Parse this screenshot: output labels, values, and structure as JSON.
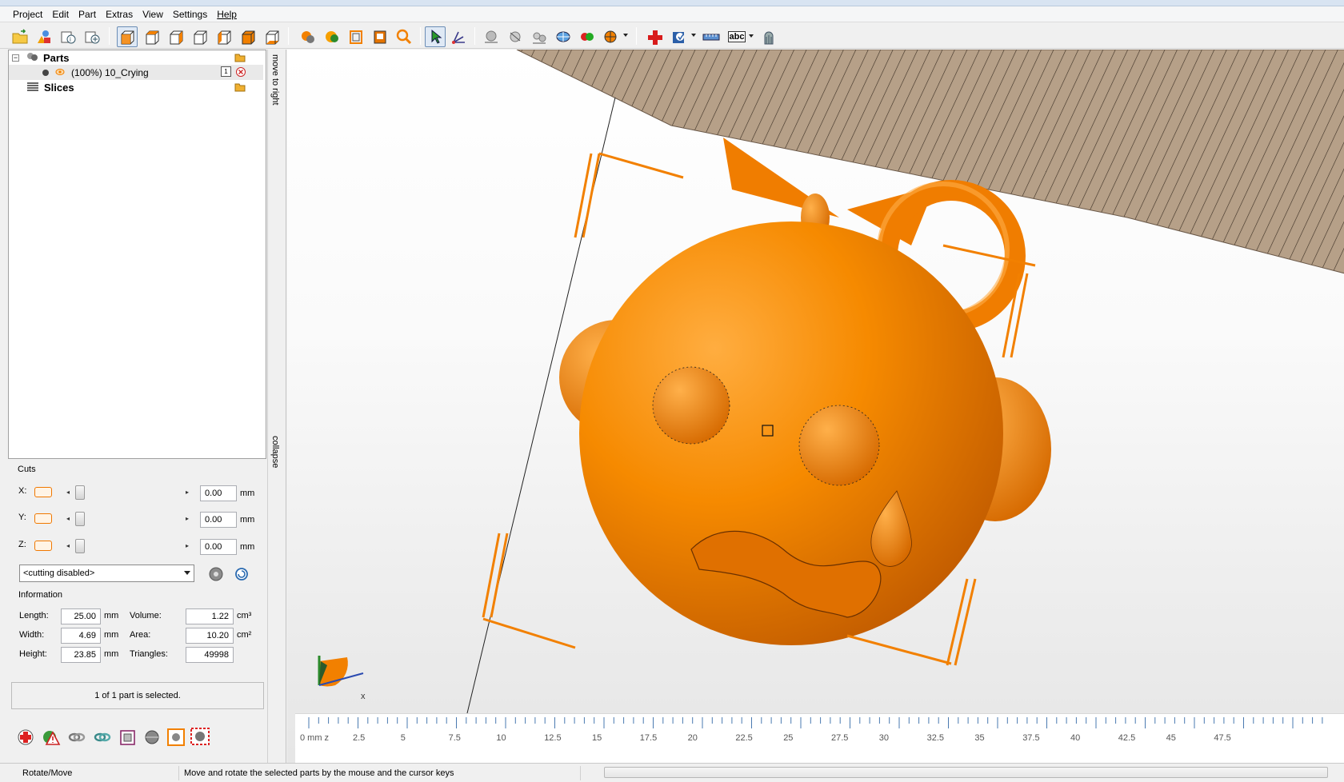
{
  "menu": {
    "items": [
      "Project",
      "Edit",
      "Part",
      "Extras",
      "View",
      "Settings",
      "Help"
    ]
  },
  "toolbar": {
    "icons": [
      "open-folder-icon",
      "add-part-icon",
      "part-info-icon",
      "add-copy-icon",
      "view-3d-icon",
      "view-front-icon",
      "view-right-icon",
      "view-back-icon",
      "view-left-icon",
      "view-top-icon",
      "view-bottom-icon",
      "render-solid-icon",
      "render-shaded-icon",
      "render-wireframe-icon",
      "render-transparent-icon",
      "zoom-icon",
      "select-arrow-icon",
      "measure-icon",
      "sphere-icon",
      "sphere-cut-icon",
      "spheres-icon",
      "texture-sphere-icon",
      "red-green-spheres-icon",
      "color-sphere-icon",
      "repair-cross-icon",
      "report-icon",
      "ruler-icon",
      "text-label-icon",
      "stand-icon"
    ],
    "text_label": "abc"
  },
  "tree": {
    "parts_label": "Parts",
    "part_item": "(100%) 10_Crying",
    "part_count": "1",
    "slices_label": "Slices"
  },
  "side_tabs": {
    "move_to_right": "move to right",
    "collapse": "collapse"
  },
  "cuts": {
    "title": "Cuts",
    "axes": [
      {
        "label": "X:",
        "value": "0.00",
        "unit": "mm"
      },
      {
        "label": "Y:",
        "value": "0.00",
        "unit": "mm"
      },
      {
        "label": "Z:",
        "value": "0.00",
        "unit": "mm"
      }
    ],
    "mode": "<cutting disabled>"
  },
  "information": {
    "title": "Information",
    "length_label": "Length:",
    "length": "25.00",
    "length_unit": "mm",
    "width_label": "Width:",
    "width": "4.69",
    "width_unit": "mm",
    "height_label": "Height:",
    "height": "23.85",
    "height_unit": "mm",
    "volume_label": "Volume:",
    "volume": "1.22",
    "volume_unit": "cm³",
    "area_label": "Area:",
    "area": "10.20",
    "area_unit": "cm²",
    "triangles_label": "Triangles:",
    "triangles": "49998"
  },
  "selection_status": "1 of 1 part is selected.",
  "bottom_tools": [
    "repair-icon",
    "warning-icon",
    "link-icon",
    "refresh-icon",
    "box-icon",
    "sphere-gray-icon",
    "orange-square-icon",
    "gear-red-icon"
  ],
  "viewport": {
    "axis_x_label": "x",
    "ruler": {
      "unit_label": "0 mm z",
      "ticks": [
        "2.5",
        "5",
        "7.5",
        "10",
        "12.5",
        "15",
        "17.5",
        "20",
        "22.5",
        "25",
        "27.5",
        "30",
        "32.5",
        "35",
        "37.5",
        "40",
        "42.5",
        "45",
        "47.5"
      ]
    },
    "model_color": "#f28000",
    "platform_color": "#b09a80"
  },
  "statusbar": {
    "mode": "Rotate/Move",
    "hint": "Move and rotate the selected parts by the mouse and the cursor keys"
  }
}
